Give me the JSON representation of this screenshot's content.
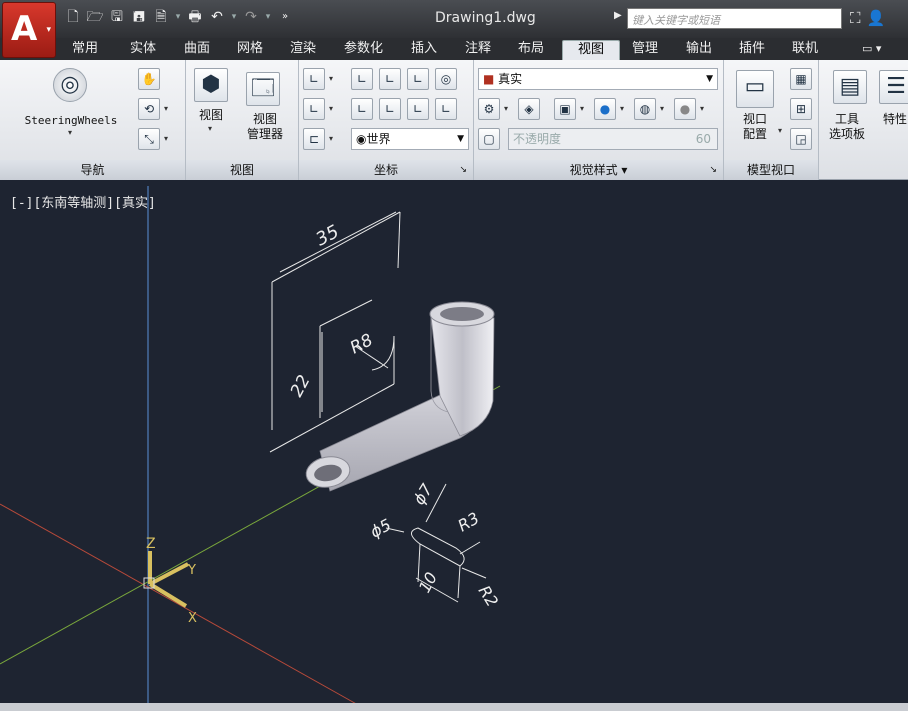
{
  "titlebar": {
    "doc_title": "Drawing1.dwg",
    "search_placeholder": "键入关键字或短语",
    "app_glyph": "A",
    "qat_icons": [
      "new-icon",
      "open-icon",
      "save-icon",
      "save-as-icon",
      "plot-preview-icon",
      "print-icon",
      "undo-icon",
      "redo-icon",
      "more-icon"
    ]
  },
  "tabs": [
    {
      "label": "常用"
    },
    {
      "label": "实体"
    },
    {
      "label": "曲面"
    },
    {
      "label": "网格"
    },
    {
      "label": "渲染"
    },
    {
      "label": "参数化"
    },
    {
      "label": "插入"
    },
    {
      "label": "注释"
    },
    {
      "label": "布局"
    },
    {
      "label": "视图",
      "active": true
    },
    {
      "label": "管理"
    },
    {
      "label": "输出"
    },
    {
      "label": "插件"
    },
    {
      "label": "联机"
    }
  ],
  "ribbon": {
    "nav": {
      "title": "导航",
      "steering": "SteeringWheels"
    },
    "view": {
      "title": "视图",
      "view_btn": "视图",
      "view_mgr_line1": "视图",
      "view_mgr_line2": "管理器"
    },
    "coord": {
      "title": "坐标",
      "ucs_combo": "世界"
    },
    "visual": {
      "title": "视觉样式",
      "style_combo": "真实",
      "opacity_label": "不透明度",
      "opacity_value": "60"
    },
    "model_vp": {
      "title": "模型视口",
      "config_line1": "视口",
      "config_line2": "配置"
    },
    "palettes": {
      "tool_line1": "工具",
      "tool_line2": "选项板",
      "props": "特性"
    }
  },
  "viewport": {
    "label": "[-][东南等轴测][真实]",
    "dims": {
      "d35": "35",
      "r8": "R8",
      "d22": "22",
      "phi7": "ϕ7",
      "phi5": "ϕ5",
      "r3": "R3",
      "d10": "10",
      "r2": "R2"
    },
    "axes": {
      "x": "X",
      "y": "Y",
      "z": "Z"
    }
  }
}
